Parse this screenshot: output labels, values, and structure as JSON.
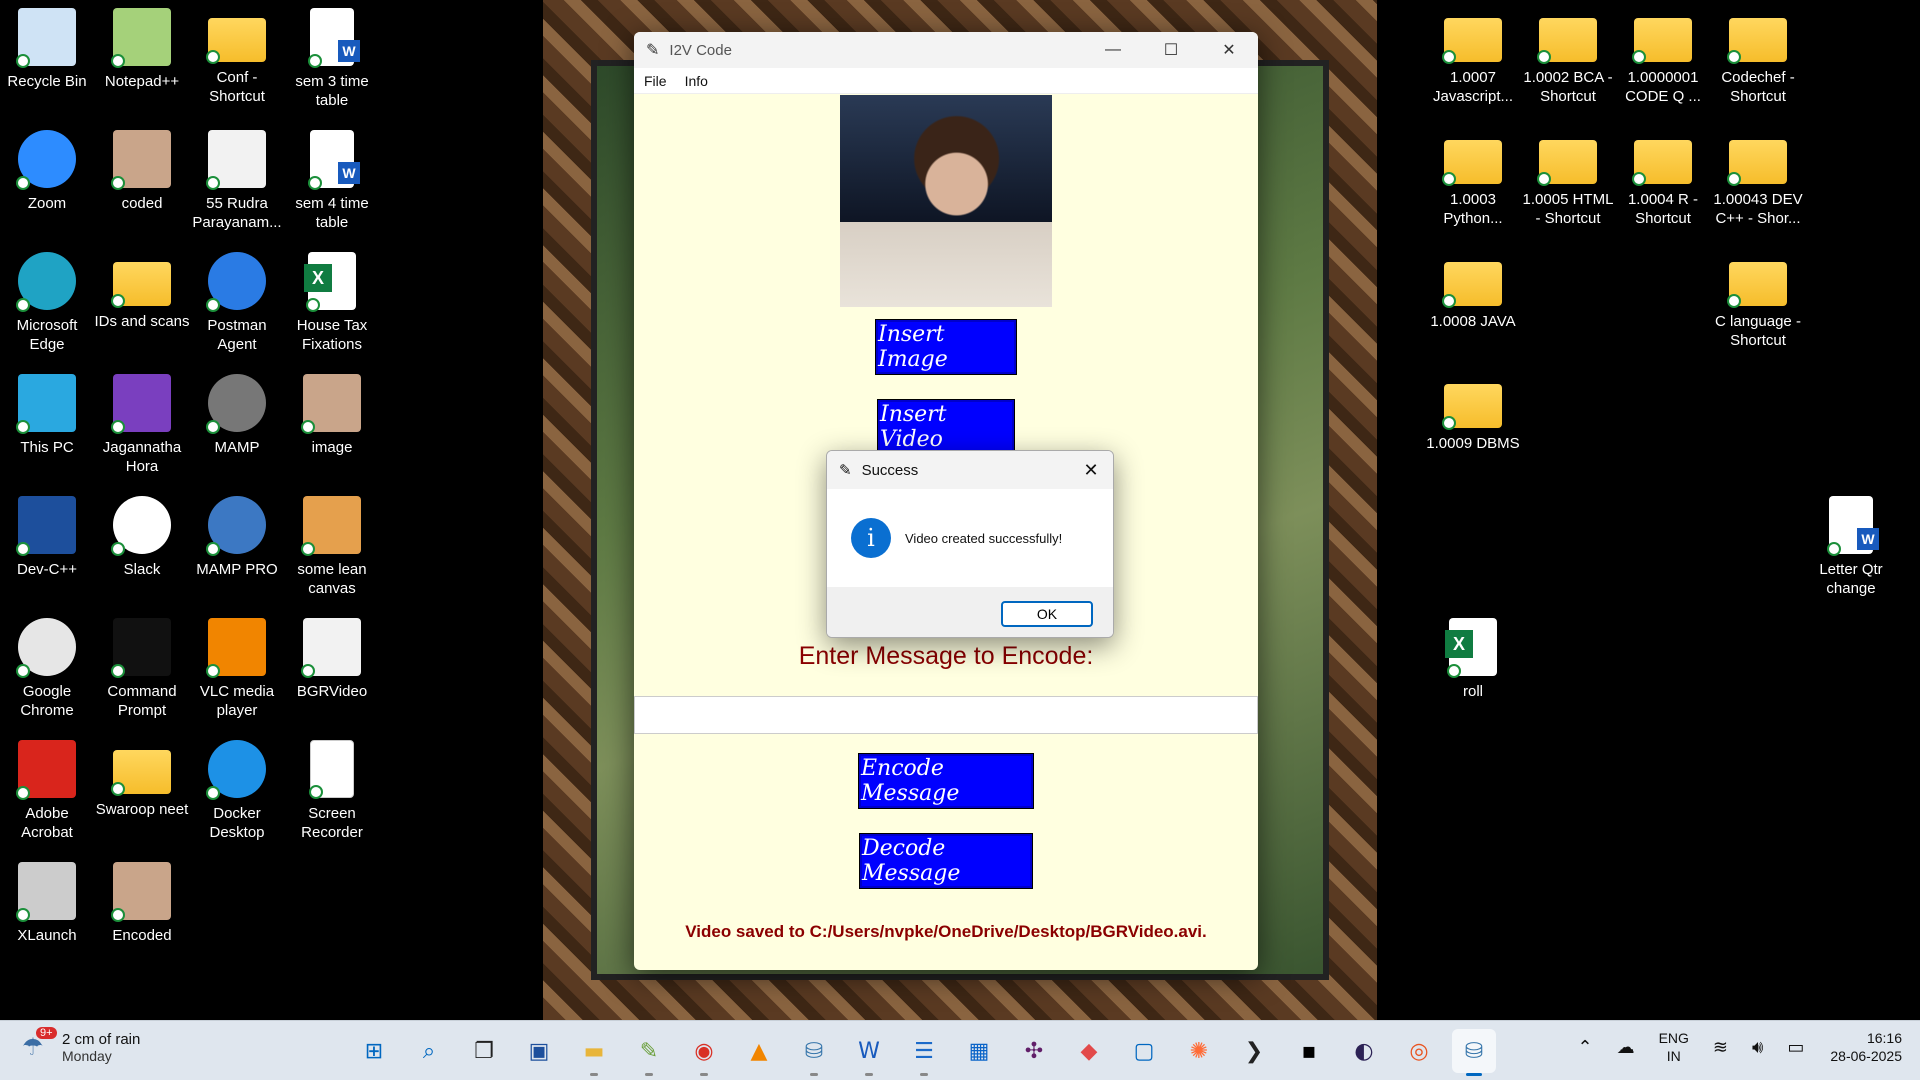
{
  "desktop": {
    "icons_left": [
      {
        "label": "Recycle Bin",
        "icon": "recycle-bin-icon"
      },
      {
        "label": "Notepad++",
        "icon": "notepadpp-icon"
      },
      {
        "label": "Conf - Shortcut",
        "icon": "folder-icon"
      },
      {
        "label": "sem 3 time table",
        "icon": "word-doc-icon"
      },
      {
        "label": "Zoom",
        "icon": "zoom-icon"
      },
      {
        "label": "coded",
        "icon": "image-icon"
      },
      {
        "label": "55 Rudra Parayanam...",
        "icon": "video-icon"
      },
      {
        "label": "sem 4 time table",
        "icon": "word-doc-icon"
      },
      {
        "label": "Microsoft Edge",
        "icon": "edge-icon"
      },
      {
        "label": "IDs and scans",
        "icon": "folder-icon"
      },
      {
        "label": "Postman Agent",
        "icon": "postman-icon"
      },
      {
        "label": "House Tax Fixations",
        "icon": "excel-icon"
      },
      {
        "label": "This PC",
        "icon": "monitor-icon"
      },
      {
        "label": "Jagannatha Hora",
        "icon": "jhora-icon"
      },
      {
        "label": "MAMP",
        "icon": "mamp-icon"
      },
      {
        "label": "image",
        "icon": "image-icon"
      },
      {
        "label": "Dev-C++",
        "icon": "devcpp-icon"
      },
      {
        "label": "Slack",
        "icon": "slack-icon"
      },
      {
        "label": "MAMP PRO",
        "icon": "mamp-pro-icon"
      },
      {
        "label": "some lean canvas",
        "icon": "canvas-icon"
      },
      {
        "label": "Google Chrome",
        "icon": "chrome-icon"
      },
      {
        "label": "Command Prompt",
        "icon": "cmd-icon"
      },
      {
        "label": "VLC media player",
        "icon": "vlc-icon"
      },
      {
        "label": "BGRVideo",
        "icon": "video-icon"
      },
      {
        "label": "Adobe Acrobat",
        "icon": "acrobat-icon"
      },
      {
        "label": "Swaroop neet",
        "icon": "folder-icon"
      },
      {
        "label": "Docker Desktop",
        "icon": "docker-icon"
      },
      {
        "label": "Screen Recorder",
        "icon": "blank-doc-icon"
      },
      {
        "label": "XLaunch",
        "icon": "xlaunch-icon"
      },
      {
        "label": "Encoded",
        "icon": "image-icon"
      }
    ],
    "icons_right": [
      {
        "label": "1.0007 Javascript...",
        "icon": "folder-icon"
      },
      {
        "label": "1.0002 BCA - Shortcut",
        "icon": "folder-icon"
      },
      {
        "label": "1.0000001 CODE Q ...",
        "icon": "folder-icon"
      },
      {
        "label": "Codechef - Shortcut",
        "icon": "folder-icon"
      },
      {
        "label": "1.0003 Python...",
        "icon": "folder-icon"
      },
      {
        "label": "1.0005 HTML - Shortcut",
        "icon": "folder-icon"
      },
      {
        "label": "1.0004 R - Shortcut",
        "icon": "folder-icon"
      },
      {
        "label": "1.00043 DEV C++ - Shor...",
        "icon": "folder-icon"
      },
      {
        "label": "1.0008 JAVA",
        "icon": "folder-icon"
      },
      {
        "label": "C language - Shortcut",
        "icon": "folder-icon"
      },
      {
        "label": "1.0009 DBMS",
        "icon": "folder-icon"
      },
      {
        "label": "Letter Qtr change",
        "icon": "word-doc-icon"
      },
      {
        "label": "roll",
        "icon": "excel-icon"
      }
    ]
  },
  "app": {
    "title": "I2V Code",
    "menu": [
      "File",
      "Info"
    ],
    "buttons": {
      "insert_image": "Insert Image",
      "insert_video": "Insert Video",
      "encode": "Encode Message",
      "decode": "Decode Message"
    },
    "enter_label": "Enter Message to Encode:",
    "message_value": "",
    "saved_status": "Video saved to C:/Users/nvpke/OneDrive/Desktop/BGRVideo.avi."
  },
  "dialog": {
    "title": "Success",
    "message": "Video created successfully!",
    "ok": "OK"
  },
  "taskbar": {
    "weather_badge": "9+",
    "weather_line1": "2 cm of rain",
    "weather_line2": "Monday",
    "apps": [
      "windows-start-icon",
      "search-icon",
      "task-view-icon",
      "devto-icon",
      "file-explorer-icon",
      "notepadpp-icon",
      "chrome-icon",
      "vlc-icon",
      "python-idle-icon",
      "word-icon",
      "notepad-icon",
      "store-icon",
      "slack-icon",
      "app-grid-icon",
      "window-icon",
      "postman-icon",
      "terminal-icon",
      "cmd-icon",
      "eclipse-icon",
      "ubuntu-icon",
      "python-icon"
    ],
    "lang1": "ENG",
    "lang2": "IN",
    "time": "16:16",
    "date": "28-06-2025"
  },
  "colors": {
    "app_bg": "#ffffe0",
    "button_blue": "#0000ff",
    "label_red": "#8b0000",
    "info_blue": "#0a6fd1"
  }
}
